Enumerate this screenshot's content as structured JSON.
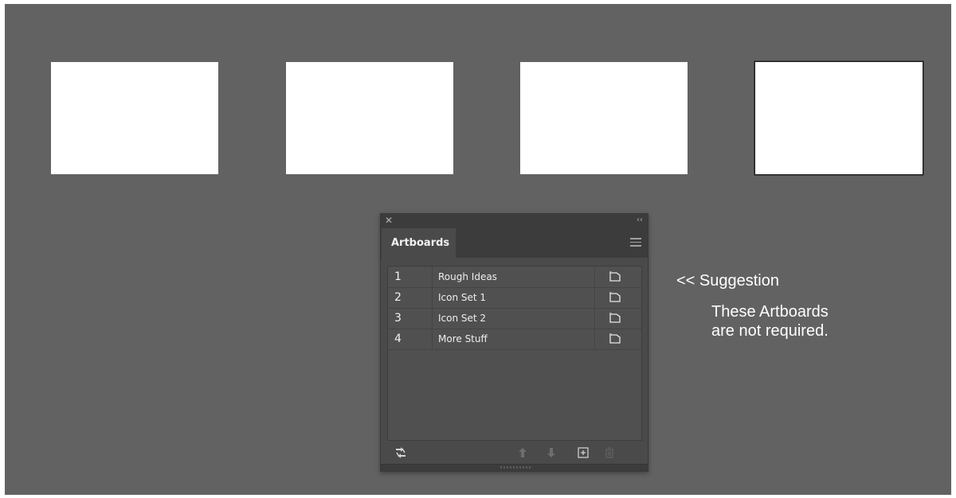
{
  "artboards_panel": {
    "tab_label": "Artboards",
    "close_glyph": "✕",
    "collapse_glyph": "‹‹",
    "rows": [
      {
        "number": "1",
        "name": "Rough Ideas"
      },
      {
        "number": "2",
        "name": "Icon Set 1"
      },
      {
        "number": "3",
        "name": "Icon Set 2"
      },
      {
        "number": "4",
        "name": "More Stuff"
      }
    ],
    "footer_icons": [
      "rearrange-icon",
      "move-up-icon",
      "move-down-icon",
      "new-artboard-icon",
      "delete-icon"
    ],
    "row_option_icon": "artboard-options-icon",
    "menu_icon": "panel-menu-icon"
  },
  "annotation": {
    "suggestion": "<< Suggestion",
    "line1": "These Artboards",
    "line2": "are not required."
  },
  "colors": {
    "canvas": "#626262",
    "artboard": "#ffffff",
    "panel": "#4a4a4a",
    "panel_dark": "#3c3c3c"
  }
}
